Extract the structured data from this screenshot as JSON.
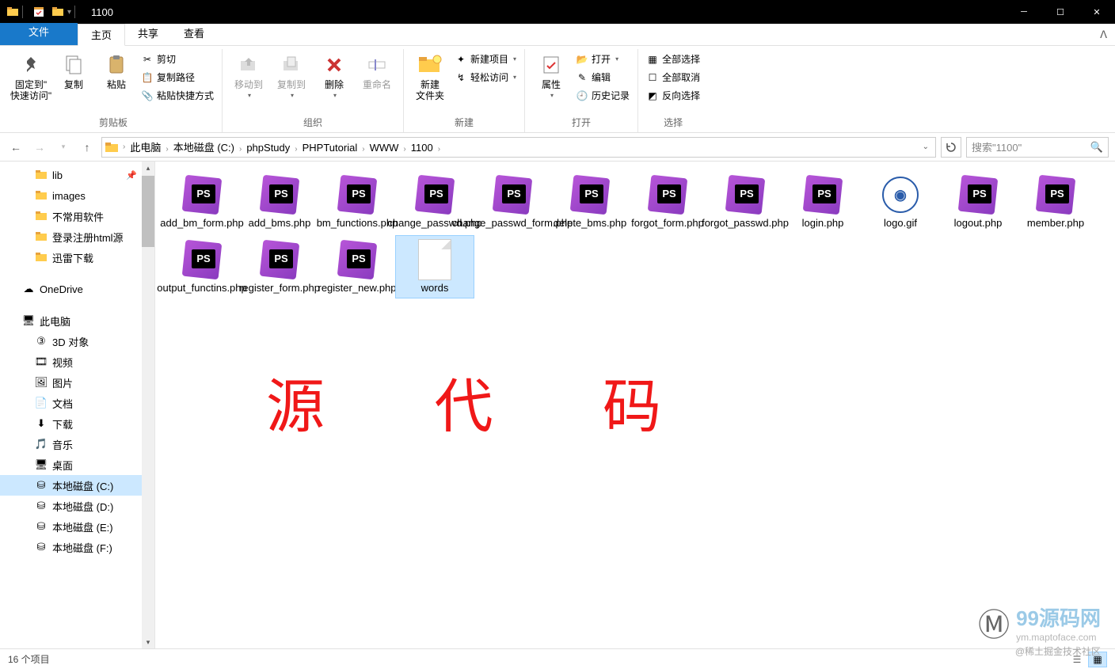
{
  "window": {
    "title": "1100"
  },
  "tabs": {
    "file": "文件",
    "home": "主页",
    "share": "共享",
    "view": "查看"
  },
  "ribbon": {
    "groups": {
      "clipboard": {
        "label": "剪贴板",
        "pin": "固定到\"\n快速访问\"",
        "copy": "复制",
        "paste": "粘贴",
        "cut": "剪切",
        "copy_path": "复制路径",
        "paste_shortcut": "粘贴快捷方式"
      },
      "organize": {
        "label": "组织",
        "move_to": "移动到",
        "copy_to": "复制到",
        "delete": "删除",
        "rename": "重命名"
      },
      "new": {
        "label": "新建",
        "new_folder": "新建\n文件夹",
        "new_item": "新建项目",
        "easy_access": "轻松访问"
      },
      "open": {
        "label": "打开",
        "properties": "属性",
        "open": "打开",
        "edit": "编辑",
        "history": "历史记录"
      },
      "select": {
        "label": "选择",
        "select_all": "全部选择",
        "select_none": "全部取消",
        "invert": "反向选择"
      }
    }
  },
  "breadcrumbs": [
    "此电脑",
    "本地磁盘 (C:)",
    "phpStudy",
    "PHPTutorial",
    "WWW",
    "1100"
  ],
  "search": {
    "placeholder": "搜索\"1100\""
  },
  "sidebar": {
    "quick": [
      {
        "label": "lib",
        "pinned": true
      },
      {
        "label": "images"
      },
      {
        "label": "不常用软件"
      },
      {
        "label": "登录注册html源"
      },
      {
        "label": "迅雷下载"
      }
    ],
    "onedrive": "OneDrive",
    "thispc": "此电脑",
    "thispc_children": [
      {
        "label": "3D 对象",
        "icon": "cube"
      },
      {
        "label": "视频",
        "icon": "video"
      },
      {
        "label": "图片",
        "icon": "picture"
      },
      {
        "label": "文档",
        "icon": "doc"
      },
      {
        "label": "下载",
        "icon": "download"
      },
      {
        "label": "音乐",
        "icon": "music"
      },
      {
        "label": "桌面",
        "icon": "desktop"
      },
      {
        "label": "本地磁盘 (C:)",
        "icon": "disk",
        "selected": true
      },
      {
        "label": "本地磁盘 (D:)",
        "icon": "disk"
      },
      {
        "label": "本地磁盘 (E:)",
        "icon": "disk"
      },
      {
        "label": "本地磁盘 (F:)",
        "icon": "disk"
      }
    ]
  },
  "files": [
    {
      "name": "add_bm_form.php",
      "type": "ps"
    },
    {
      "name": "add_bms.php",
      "type": "ps"
    },
    {
      "name": "bm_functions.php",
      "type": "ps"
    },
    {
      "name": "change_passwd.php",
      "type": "ps"
    },
    {
      "name": "change_passwd_form.php",
      "type": "ps"
    },
    {
      "name": "delete_bms.php",
      "type": "ps"
    },
    {
      "name": "forgot_form.php",
      "type": "ps"
    },
    {
      "name": "forgot_passwd.php",
      "type": "ps"
    },
    {
      "name": "login.php",
      "type": "ps"
    },
    {
      "name": "logo.gif",
      "type": "logo"
    },
    {
      "name": "logout.php",
      "type": "ps"
    },
    {
      "name": "member.php",
      "type": "ps"
    },
    {
      "name": "output_functins.php",
      "type": "ps"
    },
    {
      "name": "register_form.php",
      "type": "ps"
    },
    {
      "name": "register_new.php",
      "type": "ps"
    },
    {
      "name": "words",
      "type": "blank",
      "selected": true
    }
  ],
  "status": {
    "count_label": "16 个项目"
  },
  "handwriting": "源 代 码",
  "watermark": {
    "brand": "99源码网",
    "url": "ym.maptoface.com",
    "badge": "@稀土掘金技术社区"
  }
}
